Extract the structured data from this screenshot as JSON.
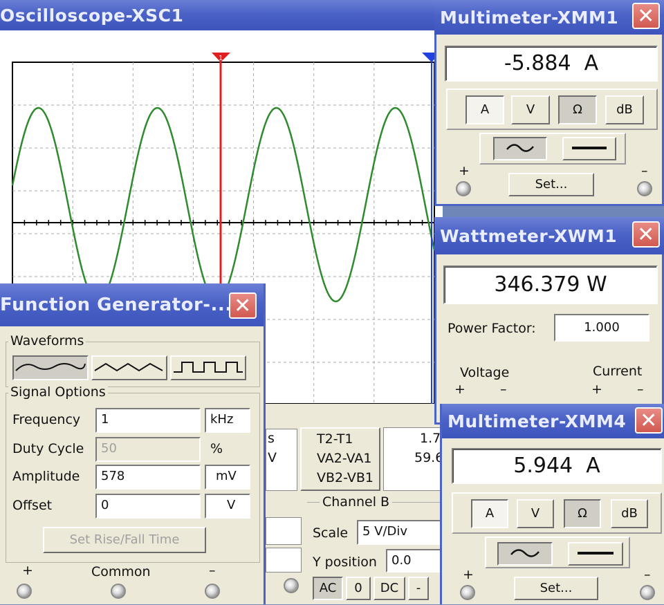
{
  "oscilloscope": {
    "title": "Oscilloscope-XSC1",
    "partial_table": {
      "col1": [
        "s",
        "V"
      ],
      "rows": [
        "T2-T1",
        "VA2-VA1",
        "VB2-VB1"
      ],
      "col3": [
        "1.7",
        "59.6"
      ]
    },
    "channel_b": {
      "header": "Channel B",
      "scale_label": "Scale",
      "scale_value": "5 V/Div",
      "ypos_label": "Y position",
      "ypos_value": "0.0",
      "coupling_buttons": [
        "AC",
        "0",
        "DC",
        "-"
      ]
    }
  },
  "function_generator": {
    "title": "Function Generator-...",
    "waveforms_label": "Waveforms",
    "waveform_icons": [
      "sine-wave-icon",
      "triangle-wave-icon",
      "square-wave-icon"
    ],
    "signal_options_label": "Signal Options",
    "rows": [
      {
        "label": "Frequency",
        "value": "1",
        "unit": "kHz"
      },
      {
        "label": "Duty Cycle",
        "value": "50",
        "unit": "%"
      },
      {
        "label": "Amplitude",
        "value": "578",
        "unit": "mV"
      },
      {
        "label": "Offset",
        "value": "0",
        "unit": "V"
      }
    ],
    "rise_fall_button": "Set Rise/Fall Time",
    "terminals": {
      "plus": "+",
      "common": "Common",
      "minus": "–"
    }
  },
  "multimeter1": {
    "title": "Multimeter-XMM1",
    "reading": "-5.884  A",
    "mode_buttons": [
      "A",
      "V",
      "Ω",
      "dB"
    ],
    "set_button": "Set...",
    "plus": "+",
    "minus": "–"
  },
  "wattmeter": {
    "title": "Wattmeter-XWM1",
    "reading": "346.379 W",
    "power_factor_label": "Power Factor:",
    "power_factor_value": "1.000",
    "voltage_label": "Voltage",
    "current_label": "Current",
    "plus": "+",
    "minus": "–"
  },
  "multimeter4": {
    "title": "Multimeter-XMM4",
    "reading": "5.944  A",
    "mode_buttons": [
      "A",
      "V",
      "Ω",
      "dB"
    ],
    "set_button": "Set...",
    "plus": "+",
    "minus": "–"
  },
  "colors": {
    "titlebar": "#4b62c6",
    "trace": "#2e8b2e",
    "cursor1": "#e02020",
    "cursor2": "#2040e0",
    "close": "#d05a52"
  }
}
